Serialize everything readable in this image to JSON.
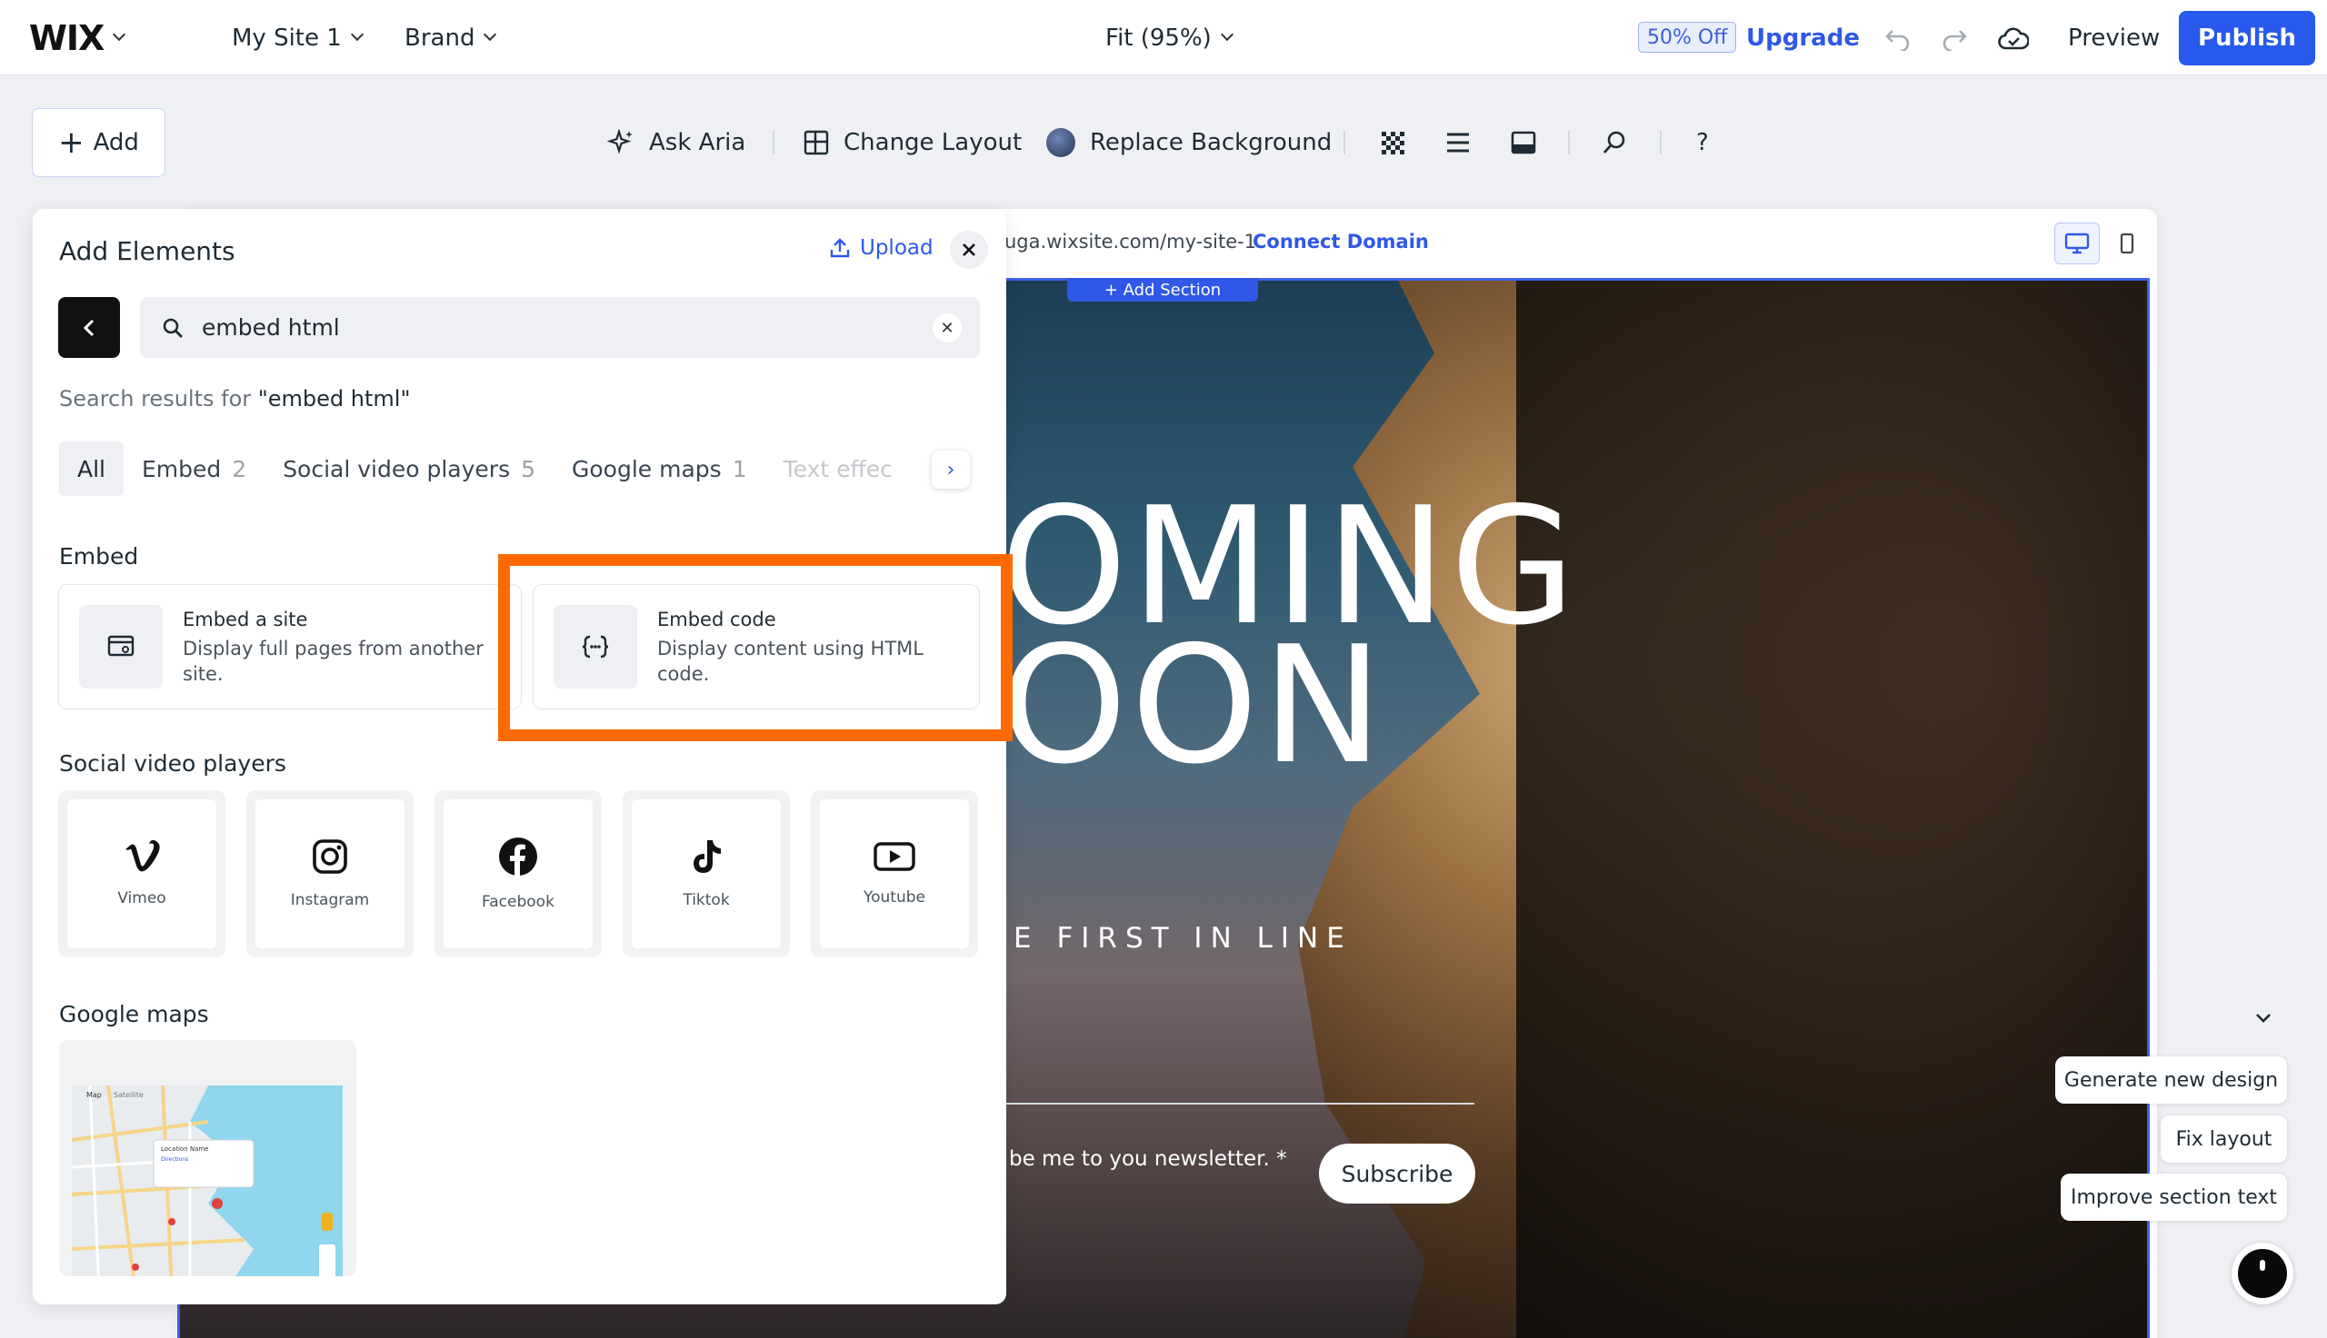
{
  "topbar": {
    "logo": "WIX",
    "site_menu": "My Site 1",
    "brand_menu": "Brand",
    "zoom_menu": "Fit (95%)",
    "promo_badge": "50% Off",
    "upgrade": "Upgrade",
    "preview": "Preview",
    "publish": "Publish"
  },
  "toolbar": {
    "add": "Add",
    "ask_aria": "Ask Aria",
    "change_layout": "Change Layout",
    "replace_background": "Replace Background",
    "help": "?"
  },
  "canvas": {
    "url": "uga.wixsite.com/my-site-1",
    "connect_domain": "Connect Domain",
    "add_section": "+ Add Section",
    "hero_line1": "OMING",
    "hero_line2": "OON",
    "tagline": "E FIRST IN LINE",
    "newsletter_label": "be me to you newsletter. *",
    "subscribe": "Subscribe"
  },
  "ai_actions": {
    "generate": "Generate new design",
    "fix_layout": "Fix layout",
    "improve_text": "Improve section text"
  },
  "panel": {
    "title": "Add Elements",
    "upload": "Upload",
    "search_value": "embed html",
    "results_prefix": "Search results for ",
    "results_query": "\"embed html\"",
    "filters": [
      {
        "label": "All",
        "count": ""
      },
      {
        "label": "Embed",
        "count": "2"
      },
      {
        "label": "Social video players",
        "count": "5"
      },
      {
        "label": "Google maps",
        "count": "1"
      },
      {
        "label": "Text effec",
        "count": ""
      }
    ],
    "embed_heading": "Embed",
    "embed_cards": [
      {
        "title": "Embed a site",
        "desc": "Display full pages from another site."
      },
      {
        "title": "Embed code",
        "desc": "Display content using HTML code."
      }
    ],
    "social_heading": "Social video players",
    "social": [
      {
        "label": "Vimeo",
        "icon": "vimeo-icon"
      },
      {
        "label": "Instagram",
        "icon": "instagram-icon"
      },
      {
        "label": "Facebook",
        "icon": "facebook-icon"
      },
      {
        "label": "Tiktok",
        "icon": "tiktok-icon"
      },
      {
        "label": "Youtube",
        "icon": "youtube-icon"
      }
    ],
    "maps_heading": "Google maps",
    "map_labels": {
      "map_tab": "Map",
      "satellite_tab": "Satellite",
      "location_name": "Location Name",
      "directions": "Directions"
    }
  },
  "colors": {
    "accent": "#2659ec",
    "highlight": "#ff6a00"
  }
}
